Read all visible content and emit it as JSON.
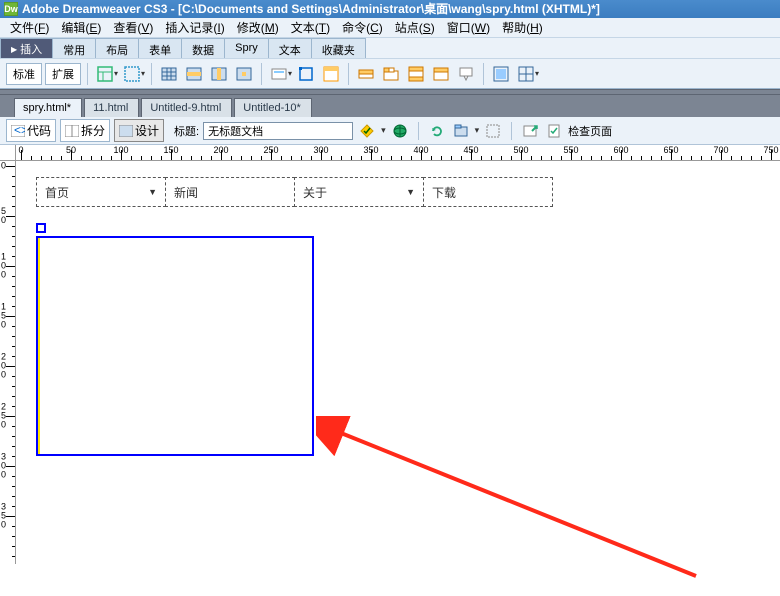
{
  "titlebar": {
    "logo": "Dw",
    "text": "Adobe Dreamweaver CS3 - [C:\\Documents and Settings\\Administrator\\桌面\\wang\\spry.html (XHTML)*]"
  },
  "menubar": {
    "items": [
      {
        "label": "文件",
        "key": "F"
      },
      {
        "label": "编辑",
        "key": "E"
      },
      {
        "label": "查看",
        "key": "V"
      },
      {
        "label": "插入记录",
        "key": "I"
      },
      {
        "label": "修改",
        "key": "M"
      },
      {
        "label": "文本",
        "key": "T"
      },
      {
        "label": "命令",
        "key": "C"
      },
      {
        "label": "站点",
        "key": "S"
      },
      {
        "label": "窗口",
        "key": "W"
      },
      {
        "label": "帮助",
        "key": "H"
      }
    ]
  },
  "insert": {
    "tabs": [
      "插入",
      "常用",
      "布局",
      "表单",
      "数据",
      "Spry",
      "文本",
      "收藏夹"
    ],
    "active": 0,
    "toolbar": {
      "btn1": "标准",
      "btn2": "扩展"
    }
  },
  "doc_tabs": {
    "tabs": [
      "spry.html*",
      "11.html",
      "Untitled-9.html",
      "Untitled-10*"
    ],
    "active": 0
  },
  "doc_toolbar": {
    "code": "代码",
    "split": "拆分",
    "design": "设计",
    "title_label": "标题:",
    "title_value": "无标题文档",
    "check_page": "检查页面"
  },
  "spry_menu": {
    "items": [
      {
        "label": "首页",
        "dropdown": true
      },
      {
        "label": "新闻",
        "dropdown": false
      },
      {
        "label": "关于",
        "dropdown": true
      },
      {
        "label": "下载",
        "dropdown": false
      }
    ]
  },
  "ruler": {
    "h_marks": [
      0,
      50,
      100,
      150,
      200,
      250,
      300,
      350,
      400,
      450,
      500,
      550,
      600,
      650,
      700,
      750
    ],
    "v_marks": [
      0,
      50,
      100,
      150,
      200,
      250,
      300,
      350
    ]
  }
}
